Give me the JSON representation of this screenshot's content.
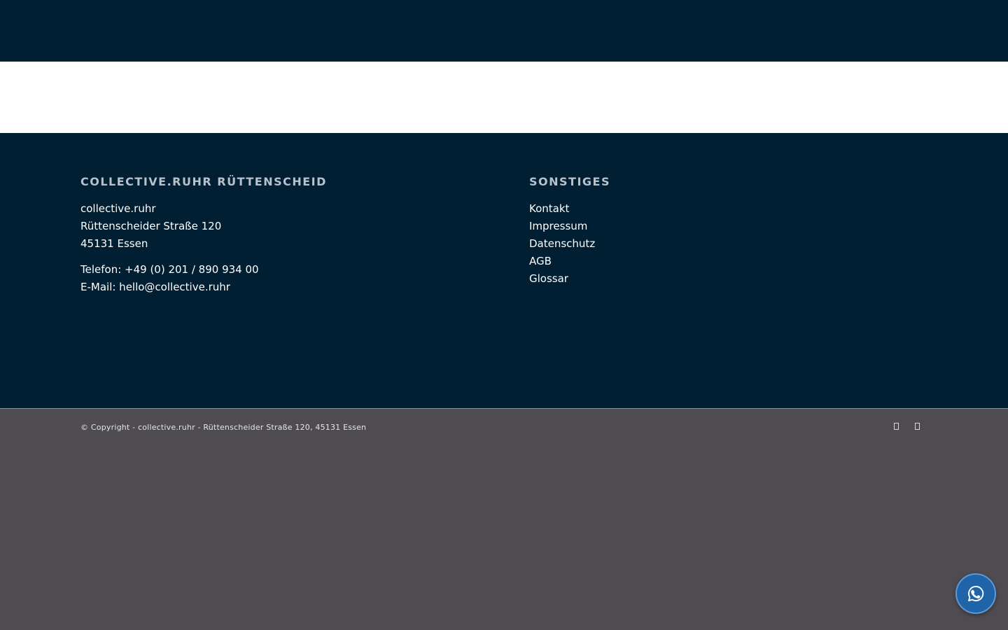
{
  "footer": {
    "left": {
      "heading": "COLLECTIVE.RUHR RÜTTENSCHEID",
      "address": [
        "collective.ruhr",
        "Rüttenscheider Straße 120",
        "45131 Essen"
      ],
      "phone": "Telefon: +49 (0) 201 / 890 934 00",
      "email": "E-Mail: hello@collective.ruhr"
    },
    "right": {
      "heading": "SONSTIGES",
      "links": [
        "Kontakt",
        "Impressum",
        "Datenschutz",
        "AGB",
        "Glossar"
      ]
    }
  },
  "socket": {
    "copyright": "© Copyright - collective.ruhr - Rüttenscheider Straße 120, 45131 Essen",
    "social_icons": [
      "social-icon",
      "social-icon"
    ]
  },
  "floating": {
    "icon": "whatsapp-icon"
  },
  "colors": {
    "navy": "#001f33",
    "socket": "#4e4c51",
    "accent": "#1f64a8"
  }
}
